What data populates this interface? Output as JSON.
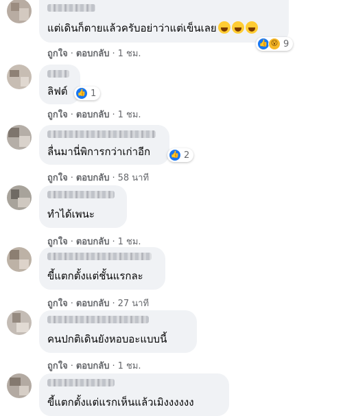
{
  "comments": [
    {
      "text": "แต่เดินก็ตายแล้วครับอย่าว่าแต่เข็นเลย",
      "reaction_count": "9",
      "time": "1 ชม."
    },
    {
      "text": "ลิฟต์",
      "reaction_count": "1",
      "time": "1 ชม."
    },
    {
      "text": "ลื่นมานี่พิการกว่าเก่าอีก",
      "reaction_count": "2",
      "time": "58 นาที"
    },
    {
      "text": "ทำได้เพนะ",
      "reaction_count": "",
      "time": "1 ชม."
    },
    {
      "text": "ขี้แตกตั้งแต่ชั้นแรกละ",
      "reaction_count": "",
      "time": "27 นาที"
    },
    {
      "text": "คนปกติเดินยังหอบอะแบบนี้",
      "reaction_count": "",
      "time": "1 ชม."
    },
    {
      "text": "ขี้แตกตั้งแต่แรกเห็นแล้วเมิงงงงงง",
      "reaction_count": "",
      "time": ""
    }
  ],
  "actions": {
    "like": "ถูกใจ",
    "reply": "ตอบกลับ",
    "separator": "·"
  },
  "icons": {
    "like": "like-icon",
    "haha": "haha-icon",
    "wow": "wow-icon"
  },
  "colors": {
    "bubble": "#f0f2f5",
    "meta": "#65676b",
    "like_blue": "#1877f2",
    "emoji_yellow": "#f7b928"
  }
}
